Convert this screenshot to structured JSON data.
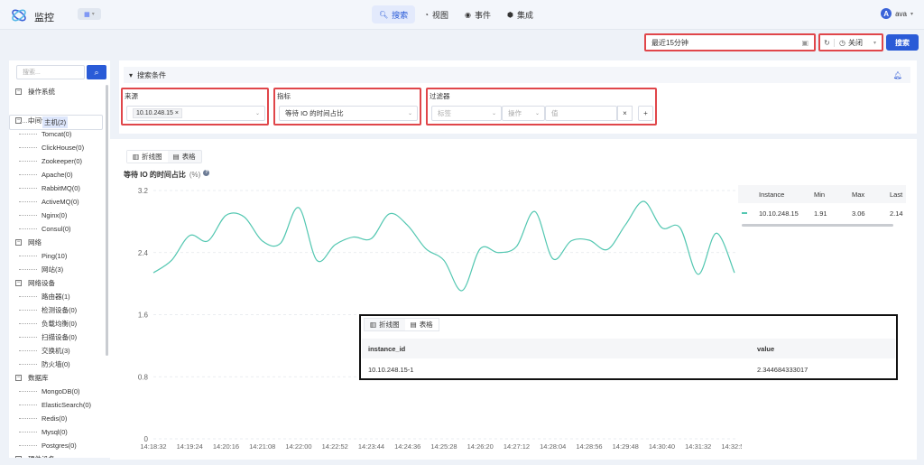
{
  "app": {
    "title": "监控",
    "switcher_icon": "grid-icon"
  },
  "nav": [
    {
      "label": "搜索",
      "icon": "search-icon",
      "active": true
    },
    {
      "label": "视图",
      "icon": "pie-icon",
      "active": false
    },
    {
      "label": "事件",
      "icon": "event-icon",
      "active": false
    },
    {
      "label": "集成",
      "icon": "cube-icon",
      "active": false
    }
  ],
  "user": {
    "initial": "A",
    "name": "ava"
  },
  "toolbar": {
    "time_range": "最近15分钟",
    "refresh_label": "关闭",
    "search_button": "搜索"
  },
  "sidebar": {
    "search_placeholder": "搜索...",
    "tree": [
      {
        "type": "group",
        "label": "操作系统"
      },
      {
        "type": "child",
        "label": "主机(2)",
        "selected": true
      },
      {
        "type": "group",
        "label": "中间件"
      },
      {
        "type": "child",
        "label": "Tomcat(0)"
      },
      {
        "type": "child",
        "label": "ClickHouse(0)"
      },
      {
        "type": "child",
        "label": "Zookeeper(0)"
      },
      {
        "type": "child",
        "label": "Apache(0)"
      },
      {
        "type": "child",
        "label": "RabbitMQ(0)"
      },
      {
        "type": "child",
        "label": "ActiveMQ(0)"
      },
      {
        "type": "child",
        "label": "Nginx(0)"
      },
      {
        "type": "child",
        "label": "Consul(0)"
      },
      {
        "type": "group",
        "label": "网络"
      },
      {
        "type": "child",
        "label": "Ping(10)"
      },
      {
        "type": "child",
        "label": "网站(3)"
      },
      {
        "type": "group",
        "label": "网络设备"
      },
      {
        "type": "child",
        "label": "路由器(1)"
      },
      {
        "type": "child",
        "label": "检测设备(0)"
      },
      {
        "type": "child",
        "label": "负载均衡(0)"
      },
      {
        "type": "child",
        "label": "扫描设备(0)"
      },
      {
        "type": "child",
        "label": "交换机(3)"
      },
      {
        "type": "child",
        "label": "防火墙(0)"
      },
      {
        "type": "group",
        "label": "数据库"
      },
      {
        "type": "child",
        "label": "MongoDB(0)"
      },
      {
        "type": "child",
        "label": "ElasticSearch(0)"
      },
      {
        "type": "child",
        "label": "Redis(0)"
      },
      {
        "type": "child",
        "label": "Mysql(0)"
      },
      {
        "type": "child",
        "label": "Postgres(0)"
      },
      {
        "type": "group",
        "label": "硬件设备"
      }
    ]
  },
  "conditions": {
    "title": "搜索条件",
    "source": {
      "label": "来源",
      "tag": "10.10.248.15"
    },
    "metric": {
      "label": "指标",
      "value": "等待 IO 的时间占比"
    },
    "filter": {
      "label": "过滤器",
      "ph1": "标签",
      "ph2": "操作",
      "ph3": "值",
      "clear": "×",
      "add": "+"
    }
  },
  "chart_tabs": {
    "line": "折线图",
    "table": "表格"
  },
  "chart_data": {
    "type": "line",
    "title": "等待 IO 的时间占比",
    "unit": "(%)",
    "ylim": [
      0,
      3.2
    ],
    "y_ticks": [
      "3.2",
      "2.4",
      "1.6",
      "0.8",
      "0"
    ],
    "y_tick_values": [
      3.2,
      2.4,
      1.6,
      0.8,
      0
    ],
    "x_ticks": [
      "14:18:32",
      "14:19:24",
      "14:20:16",
      "14:21:08",
      "14:22:00",
      "14:22:52",
      "14:23:44",
      "14:24:36",
      "14:25:28",
      "14:26:20",
      "14:27:12",
      "14:28:04",
      "14:28:56",
      "14:29:48",
      "14:30:40",
      "14:31:32",
      "14:32:50"
    ],
    "grid": true,
    "color": "#53c7b1",
    "series": [
      {
        "name": "10.10.248.15",
        "x": [
          0,
          0.5,
          1,
          1.5,
          2,
          2.5,
          3,
          3.5,
          4,
          4.5,
          5,
          5.5,
          6,
          6.5,
          7,
          7.5,
          8,
          8.5,
          9,
          9.5,
          10,
          10.5,
          11,
          11.5,
          12,
          12.5,
          13,
          13.5,
          14,
          14.5,
          15,
          15.5,
          16
        ],
        "values": [
          2.14,
          2.3,
          2.62,
          2.55,
          2.88,
          2.86,
          2.55,
          2.52,
          2.98,
          2.3,
          2.5,
          2.6,
          2.58,
          2.9,
          2.75,
          2.45,
          2.3,
          1.91,
          2.45,
          2.4,
          2.48,
          2.93,
          2.32,
          2.55,
          2.56,
          2.44,
          2.76,
          3.06,
          2.72,
          2.72,
          2.12,
          2.65,
          2.14
        ]
      }
    ]
  },
  "legend": {
    "headers": [
      "Instance",
      "Min",
      "Max",
      "Last"
    ],
    "rows": [
      {
        "instance": "10.10.248.15",
        "min": "1.91",
        "max": "3.06",
        "last": "2.14"
      }
    ]
  },
  "popup": {
    "tabs": {
      "line": "折线图",
      "table": "表格"
    },
    "headers": [
      "instance_id",
      "value"
    ],
    "rows": [
      {
        "instance_id": "10.10.248.15-1",
        "value": "2.344684333017"
      }
    ]
  }
}
